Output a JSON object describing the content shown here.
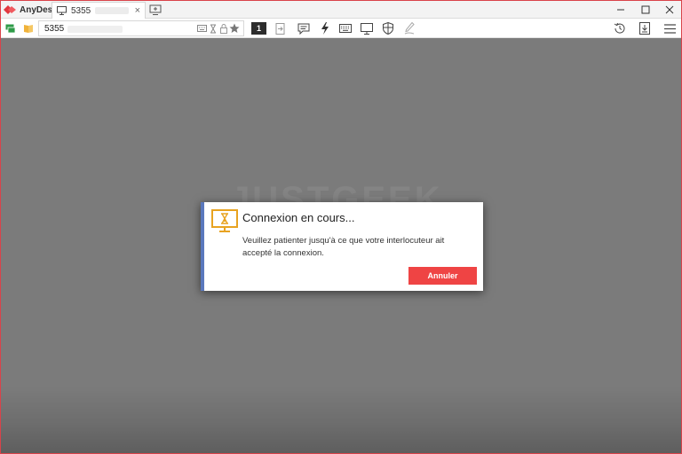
{
  "app": {
    "name": "AnyDesk",
    "brand_color": "#e2373f"
  },
  "tabs": [
    {
      "label": "5355",
      "icon": "monitor-icon",
      "close_label": "×"
    }
  ],
  "toolbar": {
    "address_value": "5355",
    "monitor_label": "1",
    "icons": [
      "keyboard-icon",
      "hourglass-icon",
      "lock-icon",
      "star-icon",
      "switch-side-icon",
      "chat-icon",
      "actions-icon",
      "keyboard-layout-icon",
      "display-icon",
      "permissions-icon",
      "whiteboard-icon",
      "history-icon",
      "file-transfer-icon",
      "menu-icon"
    ]
  },
  "watermark": {
    "text": "JUSTGEEK"
  },
  "dialog": {
    "title": "Connexion en cours...",
    "message": "Veuillez patienter jusqu'à ce que votre interlocuteur ait accepté la connexion.",
    "cancel_label": "Annuler",
    "accent_color": "#5a78bd",
    "button_color": "#ef4444",
    "icon": "hourglass-monitor-icon"
  }
}
